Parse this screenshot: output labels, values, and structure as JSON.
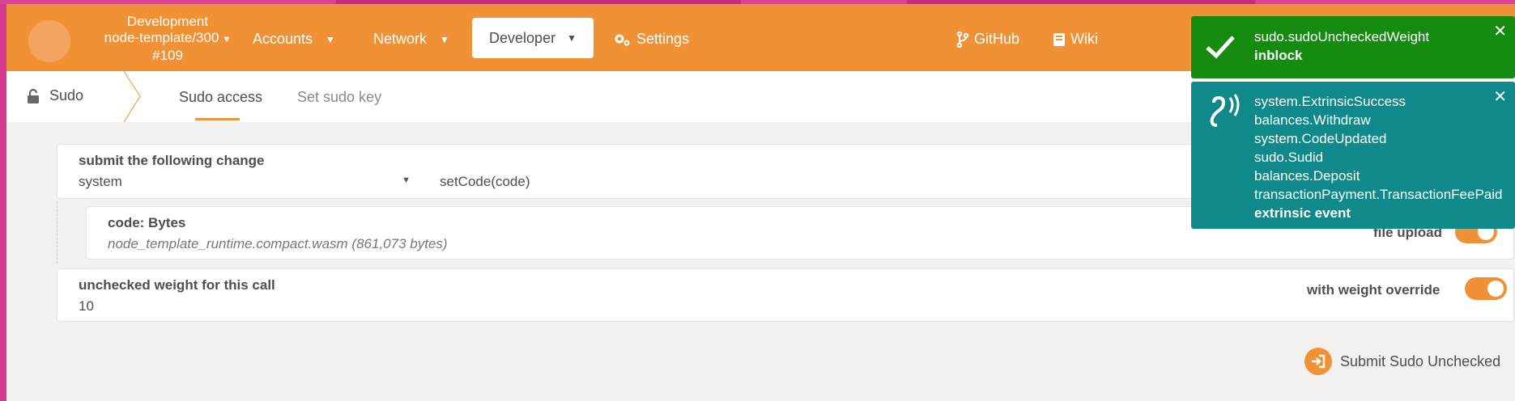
{
  "header": {
    "chain_name": "Development",
    "node": "node-template/300",
    "block": "#109",
    "nav": [
      {
        "label": "Accounts"
      },
      {
        "label": "Network"
      },
      {
        "label": "Developer"
      },
      {
        "label": "Settings"
      },
      {
        "label": "GitHub"
      },
      {
        "label": "Wiki"
      }
    ]
  },
  "tabs": {
    "section": "Sudo",
    "items": [
      {
        "label": "Sudo access",
        "active": true
      },
      {
        "label": "Set sudo key",
        "active": false
      }
    ]
  },
  "form": {
    "submit_label": "submit the following change",
    "module": "system",
    "method": "setCode(code)",
    "code_label": "code: Bytes",
    "code_value": "node_template_runtime.compact.wasm (861,073 bytes)",
    "file_upload_label": "file upload",
    "weight_label": "unchecked weight for this call",
    "weight_value": "10",
    "weight_override_label": "with weight override",
    "submit_button": "Submit Sudo Unchecked"
  },
  "notifications": {
    "success": {
      "title": "sudo.sudoUncheckedWeight",
      "status": "inblock"
    },
    "events": {
      "lines": [
        "system.ExtrinsicSuccess",
        "balances.Withdraw",
        "system.CodeUpdated",
        "sudo.Sudid",
        "balances.Deposit",
        "transactionPayment.TransactionFeePaid"
      ],
      "footer": "extrinsic event"
    }
  },
  "colors": {
    "accent": "#f19135",
    "success": "#158b10",
    "info": "#10898a"
  }
}
